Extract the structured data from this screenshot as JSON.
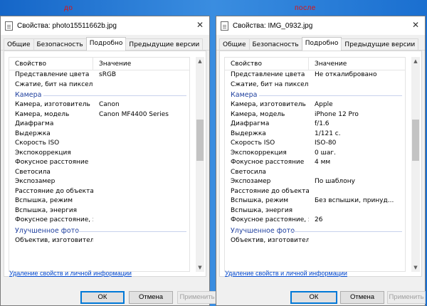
{
  "labels": {
    "before": "до",
    "after": "после"
  },
  "windows": [
    {
      "title": "Свойства: photo15511662b.jpg",
      "tabs": [
        "Общие",
        "Безопасность",
        "Подробно",
        "Предыдущие версии"
      ],
      "active_tab": "Подробно",
      "headers": {
        "property": "Свойство",
        "value": "Значение"
      },
      "rows": [
        {
          "p": "Представление цвета",
          "v": "sRGB"
        },
        {
          "p": "Сжатие, бит на пиксель",
          "v": ""
        }
      ],
      "group1": "Камера",
      "camera_rows": [
        {
          "p": "Камера, изготовитель",
          "v": "Canon"
        },
        {
          "p": "Камера, модель",
          "v": "Canon MF4400 Series"
        },
        {
          "p": "Диафрагма",
          "v": ""
        },
        {
          "p": "Выдержка",
          "v": ""
        },
        {
          "p": "Скорость ISO",
          "v": ""
        },
        {
          "p": "Экспокоррекция",
          "v": ""
        },
        {
          "p": "Фокусное расстояние",
          "v": ""
        },
        {
          "p": "Светосила",
          "v": ""
        },
        {
          "p": "Экспозамер",
          "v": ""
        },
        {
          "p": "Расстояние до объекта",
          "v": ""
        },
        {
          "p": "Вспышка, режим",
          "v": ""
        },
        {
          "p": "Вспышка, энергия",
          "v": ""
        },
        {
          "p": "Фокусное расстояние, э...",
          "v": ""
        }
      ],
      "group2": "Улучшенное фото",
      "partial_row": "Объектив, изготовитель",
      "link": "Удаление свойств и личной информации",
      "buttons": {
        "ok": "ОК",
        "cancel": "Отмена",
        "apply": "Применить"
      }
    },
    {
      "title": "Свойства: IMG_0932.jpg",
      "tabs": [
        "Общие",
        "Безопасность",
        "Подробно",
        "Предыдущие версии"
      ],
      "active_tab": "Подробно",
      "headers": {
        "property": "Свойство",
        "value": "Значение"
      },
      "rows": [
        {
          "p": "Представление цвета",
          "v": "Не откалибровано"
        },
        {
          "p": "Сжатие, бит на пиксель",
          "v": ""
        }
      ],
      "group1": "Камера",
      "camera_rows": [
        {
          "p": "Камера, изготовитель",
          "v": "Apple"
        },
        {
          "p": "Камера, модель",
          "v": "iPhone 12 Pro"
        },
        {
          "p": "Диафрагма",
          "v": "f/1.6"
        },
        {
          "p": "Выдержка",
          "v": "1/121 с."
        },
        {
          "p": "Скорость ISO",
          "v": "ISO-80"
        },
        {
          "p": "Экспокоррекция",
          "v": "0 шаг."
        },
        {
          "p": "Фокусное расстояние",
          "v": "4 мм"
        },
        {
          "p": "Светосила",
          "v": ""
        },
        {
          "p": "Экспозамер",
          "v": "По шаблону"
        },
        {
          "p": "Расстояние до объекта",
          "v": ""
        },
        {
          "p": "Вспышка, режим",
          "v": "Без вспышки, принуд..."
        },
        {
          "p": "Вспышка, энергия",
          "v": ""
        },
        {
          "p": "Фокусное расстояние, э...",
          "v": "26"
        }
      ],
      "group2": "Улучшенное фото",
      "partial_row": "Объектив, изготовитель",
      "link": "Удаление свойств и личной информации",
      "buttons": {
        "ok": "ОК",
        "cancel": "Отмена",
        "apply": "Применить"
      }
    }
  ]
}
